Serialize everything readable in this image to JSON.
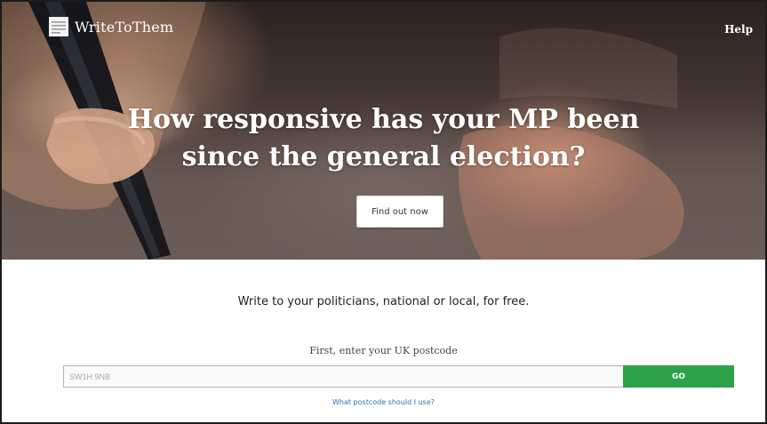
{
  "header": {
    "logo_text": "WriteToThem",
    "logo_icon": "document-icon",
    "help_label": "Help"
  },
  "hero": {
    "headline_line1": "How responsive has your MP been",
    "headline_line2": "since the general election?",
    "cta_label": "Find out now"
  },
  "main": {
    "tagline": "Write to your politicians, national or local, for free.",
    "postcode_label": "First, enter your UK postcode",
    "postcode_placeholder": "SW1H 9NB",
    "postcode_value": "",
    "go_label": "GO",
    "postcode_help_link": "What postcode should I use?"
  },
  "colors": {
    "go_button": "#2ea24a",
    "link": "#2f6fa8",
    "hero_text": "#ffffff"
  }
}
